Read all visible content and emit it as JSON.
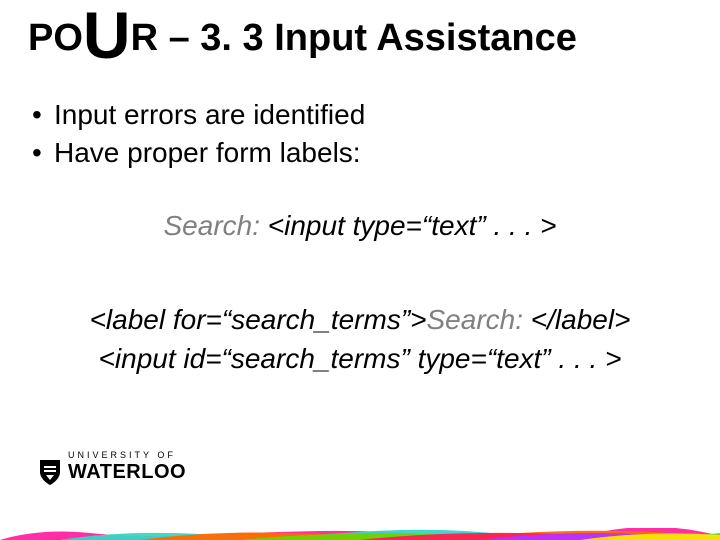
{
  "title": {
    "po": "PO",
    "u": "U",
    "rest": "R – 3. 3 Input Assistance"
  },
  "bullets": [
    "Input errors are identified",
    "Have proper form labels:"
  ],
  "code_incorrect": {
    "label": "Search:",
    "markup": " <input type=“text” . . . >"
  },
  "code_correct": {
    "line1_pre": "<label for=“search_terms”>",
    "line1_mid": "Search: ",
    "line1_post": "</label>",
    "line2": "<input id=“search_terms” type=“text” . . . >"
  },
  "logo": {
    "top": "UNIVERSITY OF",
    "word": "WATERLOO"
  },
  "strip_colors": [
    "#ff2ea6",
    "#37d6c6",
    "#ff6a00",
    "#6dd400",
    "#ff1e56",
    "#b933ff",
    "#ffe600"
  ]
}
